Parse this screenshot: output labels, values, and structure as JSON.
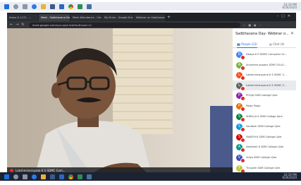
{
  "desktop": {
    "top_taskbar": {
      "clock": "10:19 PM",
      "date": "6/26/2020"
    },
    "bottom_taskbar": {
      "clock": "10:19 PM",
      "date": "6/26/2020"
    }
  },
  "browser": {
    "tabs": [
      {
        "label": "Inbox (1,117) - ...",
        "active": false
      },
      {
        "label": "Meet - Sadbhavana Day",
        "active": true
      },
      {
        "label": "Meet Attendance - Chrome...",
        "active": false
      },
      {
        "label": "My Drive - Google Drive",
        "active": false
      },
      {
        "label": "Webinar on Sadbhavana Day",
        "active": false
      }
    ],
    "url": "meet.google.com/xyn-qxyt-kdo?authuser=0"
  },
  "meet": {
    "meeting_title": "Sadbhavana Day- Webinar o...",
    "tabs": {
      "people": "People (23)",
      "chat": "Chat (4)"
    },
    "participants": [
      {
        "initial": "D",
        "name": "Deepa K P SDMC Computer Sc...",
        "color": "#4285f4",
        "highlighted": false
      },
      {
        "initial": "A",
        "name": "Anushree poojary SDM COLLE...",
        "color": "#7cb342",
        "highlighted": false
      },
      {
        "initial": "L",
        "name": "Lakshminarayana K S SDMC C...",
        "color": "#f4511e",
        "highlighted": false
      },
      {
        "initial": "L",
        "name": "Lakshminarayana K S SDMC C...",
        "color": "#616161",
        "highlighted": true
      },
      {
        "initial": "P",
        "name": "POOJA SDM College Ujire",
        "color": "#8e24aa",
        "highlighted": false
      },
      {
        "initial": "P",
        "name": "Pooja Pooja",
        "color": "#e8710a",
        "highlighted": false
      },
      {
        "initial": "S",
        "name": "SHRILLA K SDM College Ujire",
        "color": "#0b8043",
        "highlighted": false
      },
      {
        "initial": "S",
        "name": "Sandesh SDM College Ujire",
        "color": "#039be5",
        "highlighted": false
      },
      {
        "initial": "S",
        "name": "SWATHI K SDM College Ujire",
        "color": "#d50000",
        "highlighted": false
      },
      {
        "initial": "A",
        "name": "Abhishek K SDM College Ujire",
        "color": "#009688",
        "highlighted": false
      },
      {
        "initial": "V",
        "name": "Vidya SDM College Ujire",
        "color": "#3f51b5",
        "highlighted": false
      },
      {
        "initial": "T",
        "name": "Thrupthi SDM College Ujire",
        "color": "#c0ca33",
        "highlighted": false
      },
      {
        "initial": "R",
        "name": "Rakshitha SDM College Ujire",
        "color": "#ec407a",
        "highlighted": false
      }
    ],
    "self_view": {
      "label": "Lakshminarayana K S SDMC Com..."
    }
  }
}
